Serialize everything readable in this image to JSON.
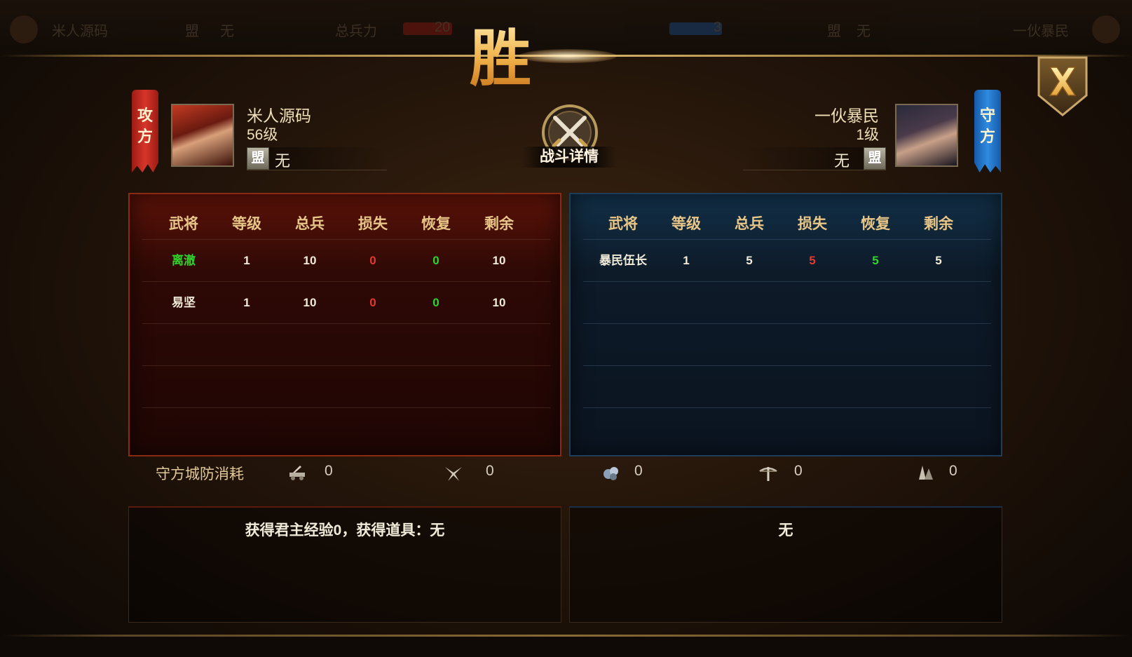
{
  "background_bar": {
    "attacker_name": "米人源码",
    "attacker_alliance": "无",
    "total_troops_label": "总兵力",
    "attacker_total": "20",
    "defender_total": "3",
    "defender_alliance": "无",
    "defender_name": "一伙暴民"
  },
  "result_title": "胜利",
  "close_icon": "close-x-icon",
  "attacker": {
    "side_label": "攻方",
    "name": "米人源码",
    "level": "56级",
    "alliance_icon": "盟",
    "alliance": "无",
    "color": "#d8352a"
  },
  "defender": {
    "side_label": "守方",
    "name": "一伙暴民",
    "level": "1级",
    "alliance_icon": "盟",
    "alliance": "无",
    "color": "#2f8be0"
  },
  "battle_detail_label": "战斗详情",
  "columns": [
    "武将",
    "等级",
    "总兵",
    "损失",
    "恢复",
    "剩余"
  ],
  "attacker_rows": [
    {
      "general": "离澈",
      "level": "1",
      "total": "10",
      "loss": "0",
      "recover": "0",
      "remain": "10",
      "highlight": true
    },
    {
      "general": "易坚",
      "level": "1",
      "total": "10",
      "loss": "0",
      "recover": "0",
      "remain": "10",
      "highlight": false
    }
  ],
  "defender_rows": [
    {
      "general": "暴民伍长",
      "level": "1",
      "total": "5",
      "loss": "5",
      "recover": "5",
      "remain": "5",
      "highlight": false
    }
  ],
  "siege": {
    "label": "守方城防消耗",
    "items": [
      {
        "icon": "catapult-icon",
        "value": "0"
      },
      {
        "icon": "caltrops-icon",
        "value": "0"
      },
      {
        "icon": "stone-icon",
        "value": "0"
      },
      {
        "icon": "crossbow-icon",
        "value": "0"
      },
      {
        "icon": "spike-icon",
        "value": "0"
      }
    ]
  },
  "rewards": {
    "attacker": "获得君主经验0，获得道具：无",
    "defender": "无"
  }
}
